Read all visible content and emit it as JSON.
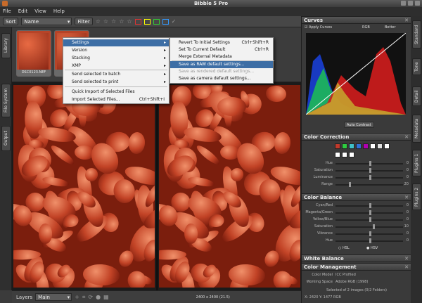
{
  "window": {
    "title": "Bibble 5 Pro"
  },
  "menubar": [
    "File",
    "Edit",
    "View",
    "Help"
  ],
  "toolbar": {
    "sort_label": "Sort",
    "sort_value": "Name",
    "filter_label": "Filter"
  },
  "sidebar_left": [
    "Library",
    "File System",
    "Output"
  ],
  "thumbnails": [
    {
      "caption": "DSC0123.NEF"
    },
    {
      "caption": ""
    }
  ],
  "context_menu": {
    "items": [
      {
        "label": "Settings",
        "has_submenu": true,
        "highlighted": true
      },
      {
        "label": "Version",
        "has_submenu": true
      },
      {
        "label": "Stacking",
        "has_submenu": true
      },
      {
        "label": "XMP",
        "has_submenu": true
      },
      {
        "label": "Send selected to batch",
        "has_submenu": true
      },
      {
        "label": "Send selected to print",
        "has_submenu": true
      },
      {
        "label": "Quick Import of Selected Files"
      },
      {
        "label": "Import Selected Files...",
        "shortcut": "Ctrl+Shift+I"
      }
    ]
  },
  "submenu": {
    "items": [
      {
        "label": "Revert To Initial Settings",
        "shortcut": "Ctrl+Shift+R"
      },
      {
        "label": "Set To Current Default",
        "shortcut": "Ctrl+R"
      },
      {
        "label": "Merge External Metadata"
      },
      {
        "label": "Save as RAW default settings...",
        "highlighted": true
      },
      {
        "label": "Save as rendered default settings...",
        "disabled": true
      },
      {
        "label": "Save as camera default settings..."
      }
    ]
  },
  "statusbar": {
    "layers_label": "Layers",
    "layer_value": "Main Layer",
    "zoom_text": "2400 x 2400 (21.5)"
  },
  "right_tabs": [
    "Standard",
    "Tone",
    "Detail",
    "Metadata",
    "Plugins 1",
    "Plugins 2"
  ],
  "curves": {
    "title": "Curves",
    "apply_label": "Apply Curves",
    "channel": "RGB",
    "mode": "Better",
    "auto_contrast": "Auto Contrast"
  },
  "color_correction": {
    "title": "Color Correction",
    "sliders": [
      {
        "label": "Hue",
        "value": "0",
        "pos": 0.5
      },
      {
        "label": "Saturation",
        "value": "0",
        "pos": 0.5
      },
      {
        "label": "Luminance",
        "value": "0",
        "pos": 0.5
      },
      {
        "label": "Range",
        "value": "20",
        "pos": 0.2
      }
    ],
    "swatches": [
      "#c0392b",
      "#2ecc40",
      "#3fc1c9",
      "#2f6fd6",
      "#b000b0",
      "#ffffff",
      "#e0e0e0",
      "#ffffff",
      "#ffffff",
      "#ffffff",
      "#ffffff"
    ]
  },
  "color_balance": {
    "title": "Color Balance",
    "sliders": [
      {
        "label": "Cyan/Red",
        "value": "0",
        "pos": 0.5
      },
      {
        "label": "Magenta/Green",
        "value": "0",
        "pos": 0.5
      },
      {
        "label": "Yellow/Blue",
        "value": "0",
        "pos": 0.5
      },
      {
        "label": "Saturation",
        "value": "10",
        "pos": 0.55
      },
      {
        "label": "Vibrance",
        "value": "0",
        "pos": 0.5
      },
      {
        "label": "Hue",
        "value": "0",
        "pos": 0.5
      }
    ],
    "radio1": "HSL",
    "radio2": "HSV"
  },
  "white_balance": {
    "title": "White Balance"
  },
  "color_management": {
    "title": "Color Management",
    "color_model_label": "Color Model",
    "color_model_value": "ICC Profiled",
    "working_space_label": "Working Space",
    "working_space_value": "Adobe RGB (1998)"
  },
  "bottom_status": "Selected of 2 images (0/2 Folders)",
  "pixel_readout": "X: 2420 Y: 1477 RGB"
}
